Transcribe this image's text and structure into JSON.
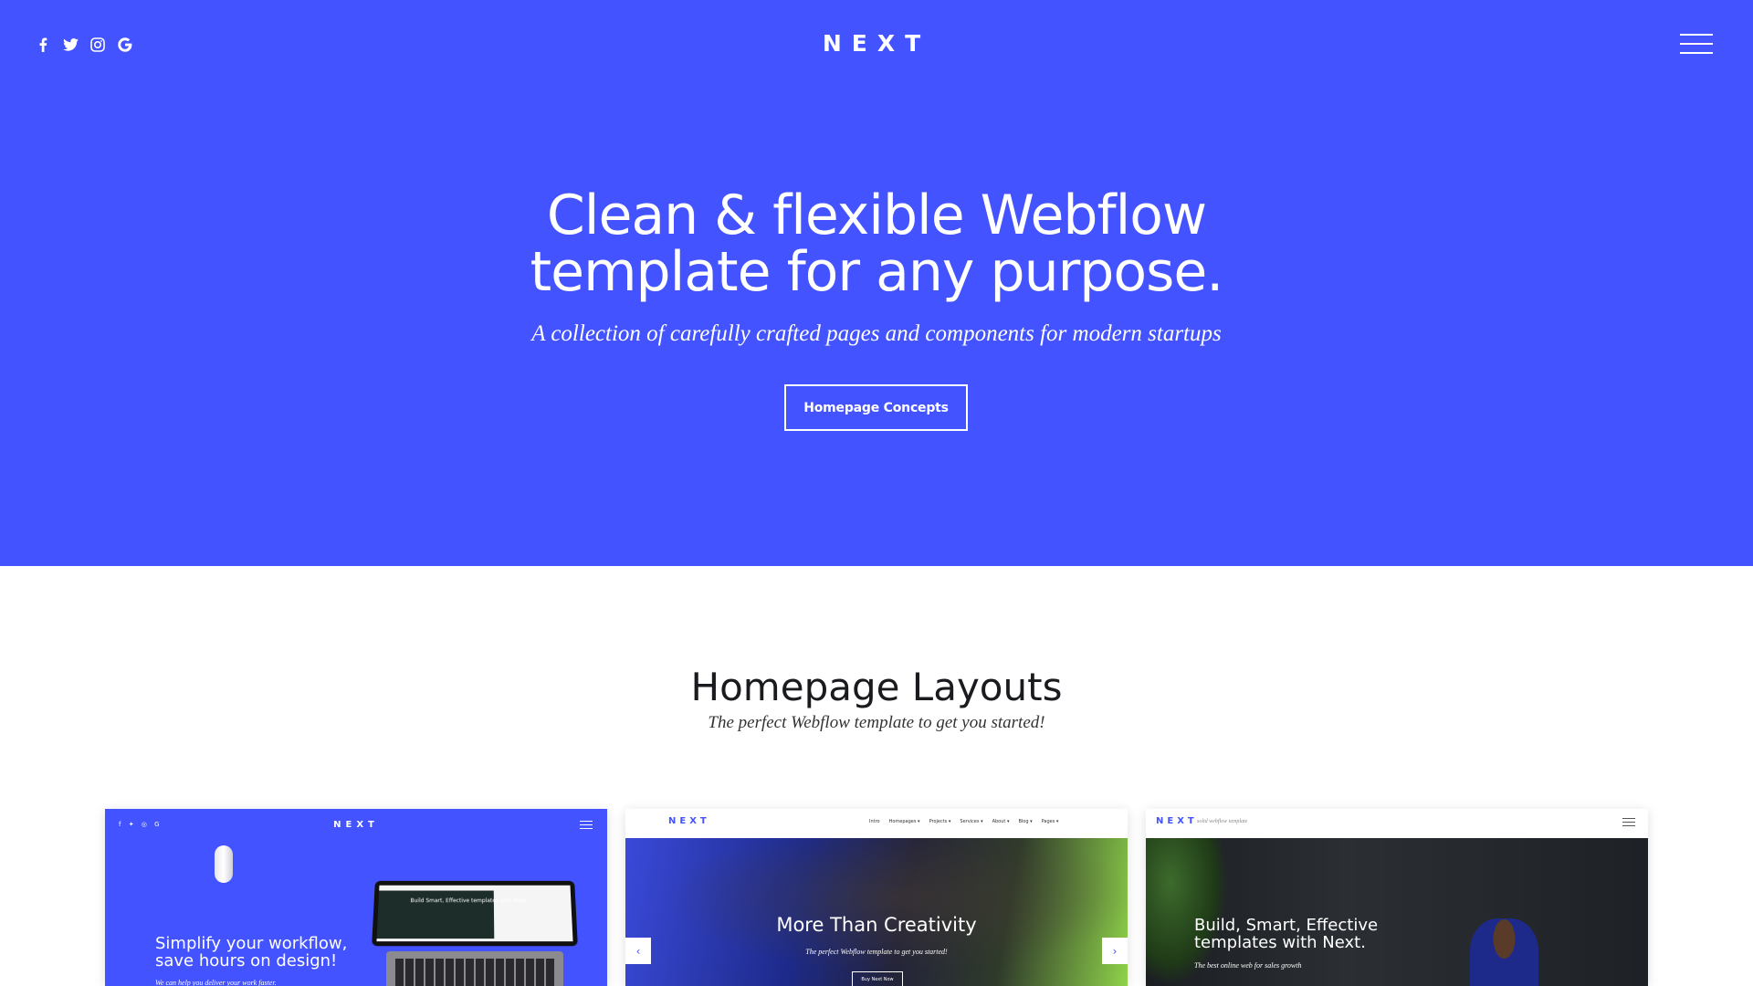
{
  "header": {
    "logo": "NEXT",
    "social_icons": [
      "facebook-icon",
      "twitter-icon",
      "instagram-icon",
      "google-icon"
    ],
    "menu_icon": "hamburger-menu-icon"
  },
  "hero": {
    "title_line1": "Clean & flexible Webflow",
    "title_line2": "template for any purpose.",
    "subtitle": "A collection of carefully crafted pages and components for modern startups",
    "button_label": "Homepage Concepts",
    "background_color": "#4353ff"
  },
  "layouts": {
    "title": "Homepage Layouts",
    "subtitle": "The perfect Webflow template to get you started!",
    "cards": [
      {
        "logo": "NEXT",
        "headline_line1": "Simplify your workflow,",
        "headline_line2": "save hours on design!",
        "subtext": "We can help you deliver your work faster.",
        "laptop_text": "Build Smart, Effective templates with Next."
      },
      {
        "logo": "NEXT",
        "nav_links": [
          "Intro",
          "Homepages ▾",
          "Projects ▾",
          "Services ▾",
          "About ▾",
          "Blog ▾",
          "Pages ▾"
        ],
        "headline": "More Than Creativity",
        "subtext": "The perfect Webflow template to get you started!",
        "button_label": "Buy Next Now"
      },
      {
        "logo": "NEXT",
        "tagline": "solid webflow template",
        "headline_line1": "Build, Smart, Effective",
        "headline_line2": "templates with Next.",
        "subtext": "The best online web for sales growth"
      }
    ]
  }
}
